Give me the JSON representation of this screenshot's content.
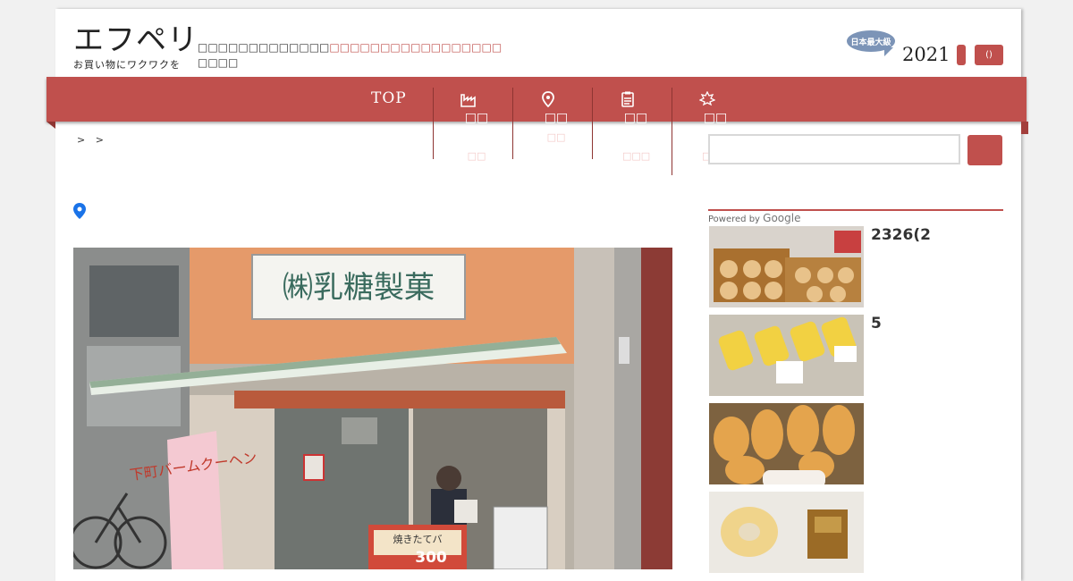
{
  "header": {
    "logo_main": "エフペリ",
    "logo_sub": "お買い物にワクワクを",
    "tagline_dark": "□□□□□□□□□□□□□",
    "tagline_red": "□□□□□□□□□□□□□□□□□",
    "tagline_line2": "□□□□",
    "badge": "日本最大級",
    "year": "2021",
    "button_small": "",
    "button_count": "()"
  },
  "nav": {
    "top": "TOP",
    "items": [
      {
        "icon": "factory-icon",
        "line1": "□□",
        "line2": "□□",
        "line3": "□□"
      },
      {
        "icon": "location-pin-icon",
        "line1": "□□",
        "line2": "□□",
        "line3": ""
      },
      {
        "icon": "checklist-icon",
        "line1": "□□",
        "line2": "□□",
        "line3": "□□□"
      },
      {
        "icon": "maple-leaf-icon",
        "line1": "□□",
        "line2": "□□",
        "line3": "□□□"
      }
    ]
  },
  "breadcrumb": "> >",
  "search": {
    "placeholder": "",
    "powered_by": "Powered by",
    "google": "Google"
  },
  "sidebar": {
    "items": [
      {
        "title": "2326(2"
      },
      {
        "title": "5"
      },
      {
        "title": ""
      },
      {
        "title": ""
      }
    ]
  },
  "photo": {
    "sign": "㈱乳糖製菓",
    "banner": "下町バームクーヘン",
    "poster": "焼きたてバ",
    "price": "300"
  },
  "colors": {
    "accent": "#c0504d",
    "badge": "#7c94b7",
    "pin": "#1a73e8"
  }
}
